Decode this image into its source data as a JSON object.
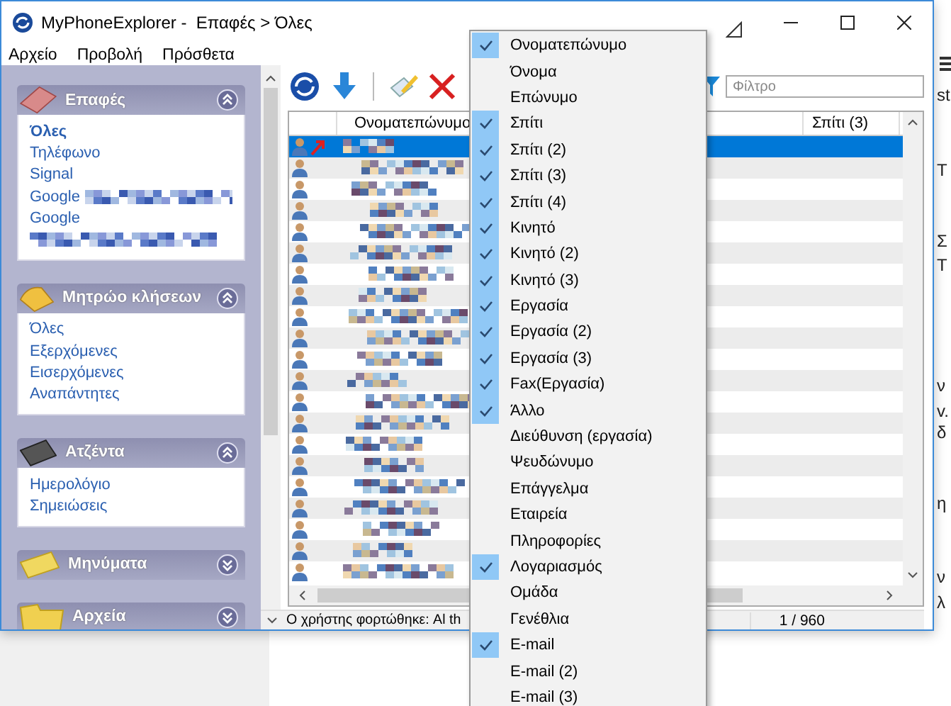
{
  "window": {
    "title": "MyPhoneExplorer -  Επαφές > Όλες"
  },
  "menu_bar": [
    "Αρχείο",
    "Προβολή",
    "Πρόσθετα"
  ],
  "sidebar": {
    "sections": [
      {
        "title": "Επαφές",
        "expanded": true,
        "items": [
          {
            "kind": "link",
            "label": "Όλες",
            "selected": true
          },
          {
            "kind": "link",
            "label": "Τηλέφωνο",
            "selected": false
          },
          {
            "kind": "link",
            "label": "Signal",
            "selected": false
          },
          {
            "kind": "link_blurred",
            "label": "Google",
            "selected": false
          },
          {
            "kind": "link",
            "label": "Google",
            "selected": false
          },
          {
            "kind": "blurred"
          }
        ]
      },
      {
        "title": "Μητρώο κλήσεων",
        "expanded": true,
        "items": [
          {
            "kind": "link",
            "label": "Όλες",
            "selected": false
          },
          {
            "kind": "link",
            "label": "Εξερχόμενες",
            "selected": false
          },
          {
            "kind": "link",
            "label": "Εισερχόμενες",
            "selected": false
          },
          {
            "kind": "link",
            "label": "Αναπάντητες",
            "selected": false
          }
        ]
      },
      {
        "title": "Ατζέντα",
        "expanded": true,
        "items": [
          {
            "kind": "link",
            "label": "Ημερολόγιο",
            "selected": false
          },
          {
            "kind": "link",
            "label": "Σημειώσεις",
            "selected": false
          }
        ]
      },
      {
        "title": "Μηνύματα",
        "expanded": false
      },
      {
        "title": "Αρχεία",
        "expanded": false
      }
    ]
  },
  "toolbar": {
    "filter": {
      "placeholder": "Φίλτρο"
    }
  },
  "table": {
    "columns": [
      "Ονοματεπώνυμο",
      "Σπίτι (3)"
    ],
    "rows": [
      {
        "selected": true,
        "missed_call": true
      },
      {
        "selected": false,
        "missed_call": false
      },
      {
        "selected": false,
        "missed_call": false
      },
      {
        "selected": false,
        "missed_call": false
      },
      {
        "selected": false,
        "missed_call": false
      },
      {
        "selected": false,
        "missed_call": false
      },
      {
        "selected": false,
        "missed_call": false
      },
      {
        "selected": false,
        "missed_call": false
      },
      {
        "selected": false,
        "missed_call": false
      },
      {
        "selected": false,
        "missed_call": false
      },
      {
        "selected": false,
        "missed_call": false
      },
      {
        "selected": false,
        "missed_call": false
      },
      {
        "selected": false,
        "missed_call": false
      },
      {
        "selected": false,
        "missed_call": false
      },
      {
        "selected": false,
        "missed_call": false
      },
      {
        "selected": false,
        "missed_call": false
      },
      {
        "selected": false,
        "missed_call": false
      },
      {
        "selected": false,
        "missed_call": false
      },
      {
        "selected": false,
        "missed_call": false
      },
      {
        "selected": false,
        "missed_call": false
      },
      {
        "selected": false,
        "missed_call": false
      }
    ]
  },
  "status_bar": {
    "message": "Ο χρήστης φορτώθηκε: Al th",
    "count": "1 / 960"
  },
  "column_menu": {
    "items": [
      {
        "label": "Ονοματεπώνυμο",
        "checked": true
      },
      {
        "label": "Όνομα",
        "checked": false
      },
      {
        "label": "Επώνυμο",
        "checked": false
      },
      {
        "label": "Σπίτι",
        "checked": true
      },
      {
        "label": "Σπίτι (2)",
        "checked": true
      },
      {
        "label": "Σπίτι (3)",
        "checked": true
      },
      {
        "label": "Σπίτι (4)",
        "checked": true
      },
      {
        "label": "Κινητό",
        "checked": true
      },
      {
        "label": "Κινητό (2)",
        "checked": true
      },
      {
        "label": "Κινητό (3)",
        "checked": true
      },
      {
        "label": "Εργασία",
        "checked": true
      },
      {
        "label": "Εργασία (2)",
        "checked": true
      },
      {
        "label": "Εργασία (3)",
        "checked": true
      },
      {
        "label": "Fax(Εργασία)",
        "checked": true
      },
      {
        "label": "Άλλο",
        "checked": true
      },
      {
        "label": "Διεύθυνση (εργασία)",
        "checked": false
      },
      {
        "label": "Ψευδώνυμο",
        "checked": false
      },
      {
        "label": "Επάγγελμα",
        "checked": false
      },
      {
        "label": "Εταιρεία",
        "checked": false
      },
      {
        "label": "Πληροφορίες",
        "checked": false
      },
      {
        "label": "Λογαριασμός",
        "checked": true
      },
      {
        "label": "Ομάδα",
        "checked": false
      },
      {
        "label": "Γενέθλια",
        "checked": false
      },
      {
        "label": "E-mail",
        "checked": true
      },
      {
        "label": "E-mail (2)",
        "checked": false
      },
      {
        "label": "E-mail (3)",
        "checked": false
      }
    ]
  },
  "background_window": {
    "lines": [
      "st",
      "T",
      "Σ",
      "Τ",
      "ν",
      "v.",
      "δ",
      "η",
      "ν",
      "λ"
    ]
  }
}
